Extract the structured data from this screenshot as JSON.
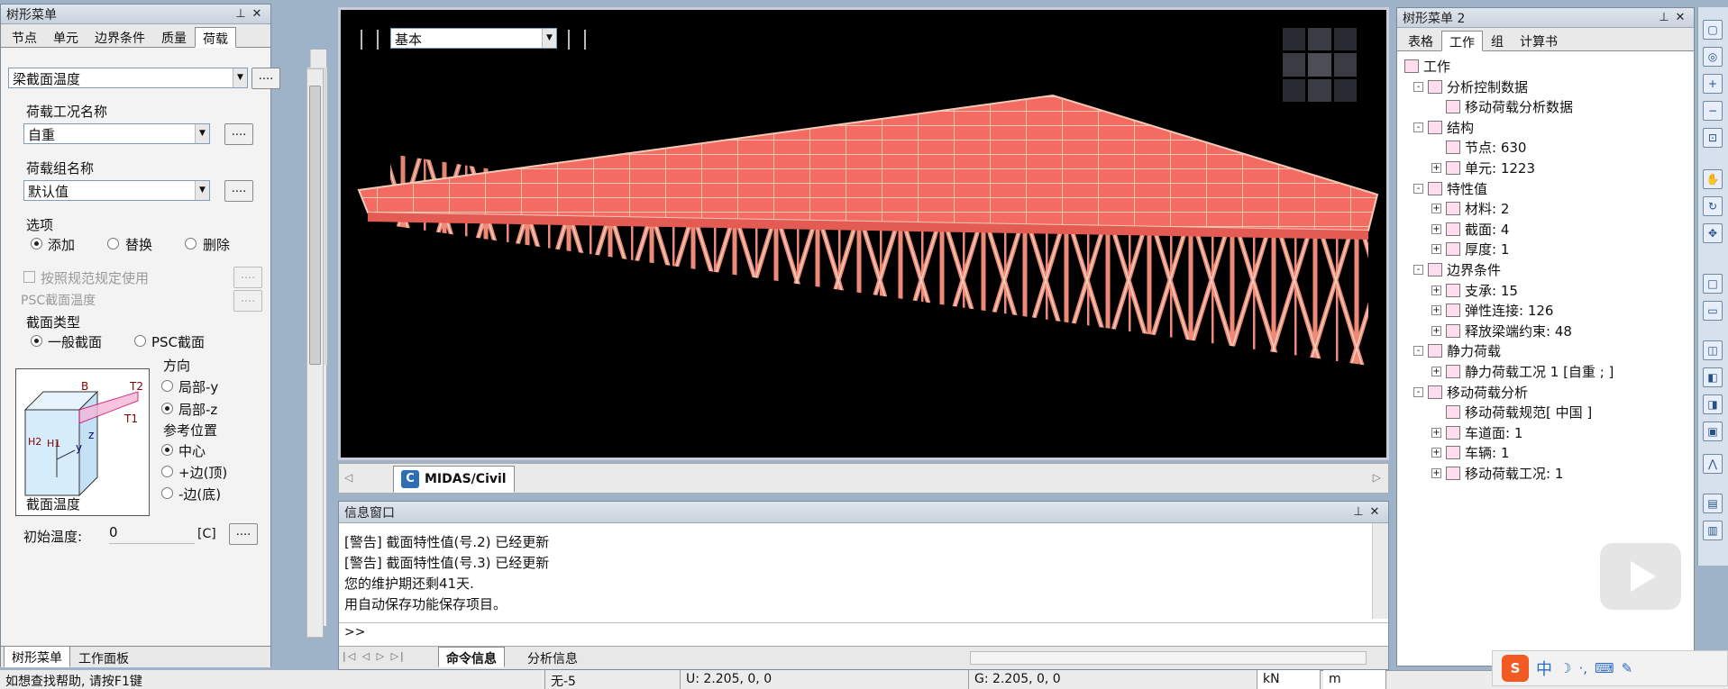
{
  "left_panel": {
    "title": "树形菜单",
    "tabs": [
      "节点",
      "单元",
      "边界条件",
      "质量",
      "荷载"
    ],
    "active_tab": 4,
    "top_select": "梁截面温度",
    "dots": "....",
    "load_case_label": "荷载工况名称",
    "load_case_value": "自重",
    "load_group_label": "荷载组名称",
    "load_group_value": "默认值",
    "options_label": "选项",
    "opt_add": "添加",
    "opt_replace": "替换",
    "opt_delete": "删除",
    "by_code": "按照规范规定使用",
    "psc_temp": "PSC截面温度",
    "section_type_label": "截面类型",
    "sec_general": "一般截面",
    "sec_psc": "PSC截面",
    "direction_label": "方向",
    "dir_local_y": "局部-y",
    "dir_local_z": "局部-z",
    "ref_pos_label": "参考位置",
    "ref_center": "中心",
    "ref_top": "+边(顶)",
    "ref_bottom": "-边(底)",
    "section_temp_label": "截面温度",
    "init_temp_label": "初始温度:",
    "init_temp_value": "0",
    "init_temp_unit": "[C]",
    "bottom_tabs": [
      "树形菜单",
      "工作面板"
    ],
    "diagram_labels": {
      "b": "B",
      "t2": "T2",
      "t1": "T1",
      "h1": "H1",
      "h2": "H2",
      "y": "y",
      "z": "z"
    }
  },
  "viewport": {
    "view_select": "基本",
    "tab_label": "MIDAS/Civil"
  },
  "message_window": {
    "title": "信息窗口",
    "lines": [
      "[警告] 截面特性值(号.2) 已经更新",
      "[警告] 截面特性值(号.3) 已经更新",
      "您的维护期还剩41天.",
      "用自动保存功能保存项目。"
    ],
    "prompt": ">>",
    "tabs": [
      "命令信息",
      "分析信息"
    ]
  },
  "right_panel": {
    "title": "树形菜单 2",
    "tabs": [
      "表格",
      "工作",
      "组",
      "计算书"
    ],
    "active_tab": 1,
    "tree": [
      {
        "level": 0,
        "label": "工作",
        "icon": "work-icon",
        "exp": ""
      },
      {
        "level": 1,
        "label": "分析控制数据",
        "icon": "analysis-control-icon",
        "exp": "-"
      },
      {
        "level": 2,
        "label": "移动荷载分析数据",
        "icon": "moving-load-data-icon",
        "exp": ""
      },
      {
        "level": 1,
        "label": "结构",
        "icon": "structure-icon",
        "exp": "-"
      },
      {
        "level": 2,
        "label": "节点: 630",
        "icon": "node-icon",
        "exp": ""
      },
      {
        "level": 2,
        "label": "单元: 1223",
        "icon": "element-icon",
        "exp": "+"
      },
      {
        "level": 1,
        "label": "特性值",
        "icon": "property-icon",
        "exp": "-"
      },
      {
        "level": 2,
        "label": "材料: 2",
        "icon": "material-icon",
        "exp": "+"
      },
      {
        "level": 2,
        "label": "截面: 4",
        "icon": "section-icon",
        "exp": "+"
      },
      {
        "level": 2,
        "label": "厚度: 1",
        "icon": "thickness-icon",
        "exp": "+"
      },
      {
        "level": 1,
        "label": "边界条件",
        "icon": "boundary-icon",
        "exp": "-"
      },
      {
        "level": 2,
        "label": "支承: 15",
        "icon": "support-icon",
        "exp": "+"
      },
      {
        "level": 2,
        "label": "弹性连接: 126",
        "icon": "elastic-link-icon",
        "exp": "+"
      },
      {
        "level": 2,
        "label": "释放梁端约束: 48",
        "icon": "beam-release-icon",
        "exp": "+"
      },
      {
        "level": 1,
        "label": "静力荷载",
        "icon": "static-load-icon",
        "exp": "-"
      },
      {
        "level": 2,
        "label": "静力荷载工况 1 [自重 ; ]",
        "icon": "static-load-case-icon",
        "exp": "+"
      },
      {
        "level": 1,
        "label": "移动荷载分析",
        "icon": "moving-load-icon",
        "exp": "-"
      },
      {
        "level": 2,
        "label": "移动荷载规范[ 中国 ]",
        "icon": "moving-load-code-icon",
        "exp": ""
      },
      {
        "level": 2,
        "label": "车道面: 1",
        "icon": "lane-icon",
        "exp": "+"
      },
      {
        "level": 2,
        "label": "车辆: 1",
        "icon": "vehicle-icon",
        "exp": "+"
      },
      {
        "level": 2,
        "label": "移动荷载工况: 1",
        "icon": "moving-load-case-icon",
        "exp": "+"
      }
    ]
  },
  "status_bar": {
    "help": "如想查找帮助, 请按F1键",
    "node": "无-5",
    "u_coord": "U: 2.205, 0, 0",
    "g_coord": "G: 2.205, 0, 0",
    "force_unit": "kN",
    "length_unit": "m"
  },
  "ime": {
    "lang": "中"
  }
}
